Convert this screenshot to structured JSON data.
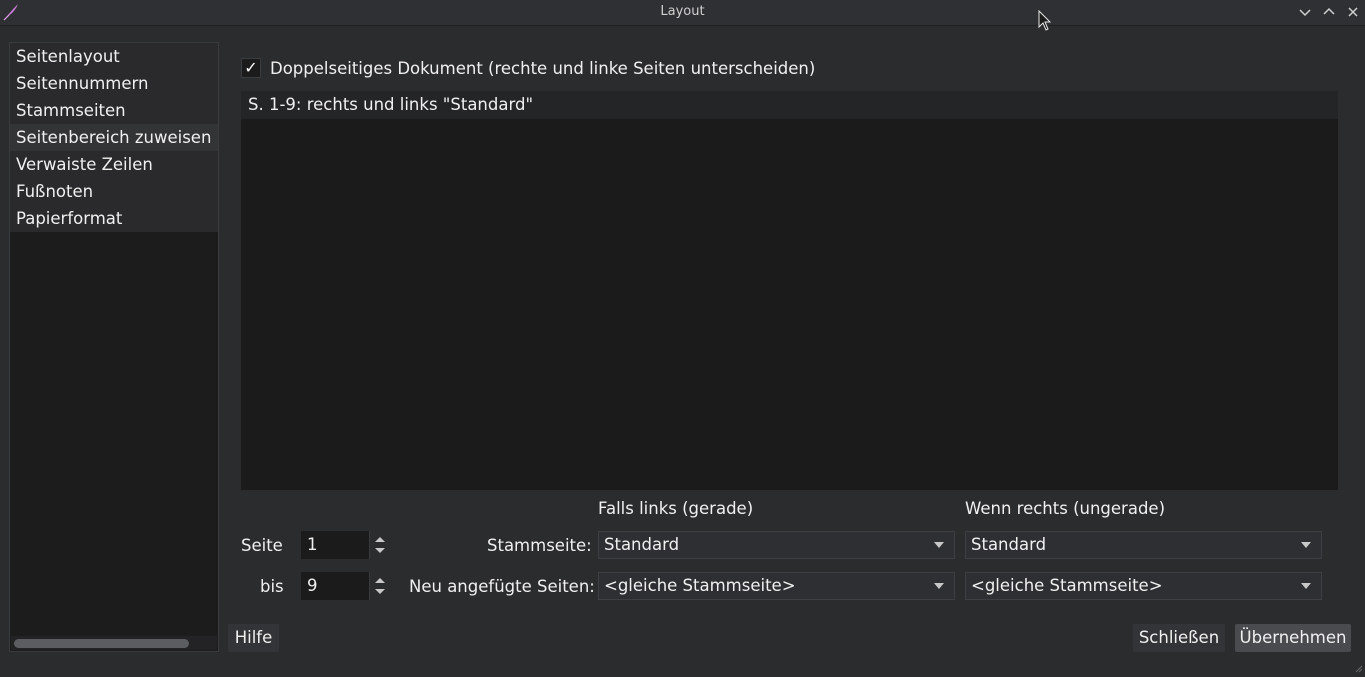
{
  "window": {
    "title": "Layout"
  },
  "sidebar": {
    "items": [
      {
        "label": "Seitenlayout"
      },
      {
        "label": "Seitennummern"
      },
      {
        "label": "Stammseiten"
      },
      {
        "label": "Seitenbereich zuweisen",
        "selected": true
      },
      {
        "label": "Verwaiste Zeilen"
      },
      {
        "label": "Fußnoten"
      },
      {
        "label": "Papierformat"
      }
    ]
  },
  "main": {
    "double_sided": {
      "label": "Doppelseitiges Dokument (rechte und linke Seiten unterscheiden)",
      "checked": true,
      "check_glyph": "✓"
    },
    "ranges": [
      {
        "label": "S. 1-9: rechts und links \"Standard\""
      }
    ],
    "headers": {
      "left": "Falls links (gerade)",
      "right": "Wenn rechts (ungerade)"
    },
    "page_from": {
      "label": "Seite",
      "value": "1"
    },
    "page_to": {
      "label": "bis",
      "value": "9"
    },
    "master_page": {
      "label": "Stammseite:",
      "left_value": "Standard",
      "right_value": "Standard"
    },
    "appended_pages": {
      "label": "Neu angefügte Seiten:",
      "left_value": "<gleiche Stammseite>",
      "right_value": "<gleiche Stammseite>"
    }
  },
  "buttons": {
    "help": "Hilfe",
    "close": "Schließen",
    "apply": "Übernehmen"
  },
  "icons": {
    "app": "app-feather-icon",
    "minimize": "chevron-down-icon",
    "maximize": "chevron-up-icon",
    "close": "close-icon"
  },
  "colors": {
    "window_bg": "#2b2c2e",
    "field_bg": "#1b1b1c",
    "text": "#f0f0f0",
    "selected_item": "#333436"
  }
}
